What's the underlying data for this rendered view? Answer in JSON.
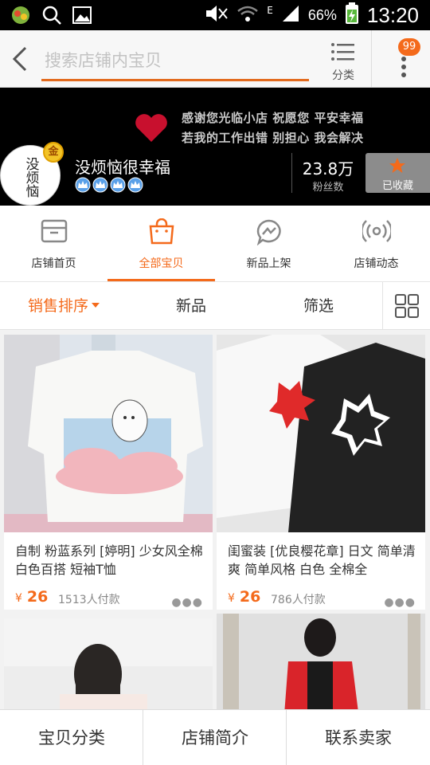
{
  "status_bar": {
    "battery_text": "66%",
    "time": "13:20",
    "network_label": "E"
  },
  "header": {
    "search_placeholder": "搜索店铺内宝贝",
    "category_label": "分类",
    "notification_count": "99"
  },
  "banner": {
    "line1": "感谢您光临小店 祝愿您 平安幸福",
    "line2": "若我的工作出错 别担心 我会解决",
    "avatar_text": "没烦恼",
    "gold_badge": "金",
    "shop_name": "没烦恼很幸福",
    "fans_count": "23.8万",
    "fans_label": "粉丝数",
    "collect_label": "已收藏"
  },
  "tabs": [
    {
      "label": "店铺首页",
      "icon": "store-icon"
    },
    {
      "label": "全部宝贝",
      "icon": "shopping-bag-icon"
    },
    {
      "label": "新品上架",
      "icon": "messenger-icon"
    },
    {
      "label": "店铺动态",
      "icon": "broadcast-icon"
    }
  ],
  "sort": {
    "sales": "销售排序",
    "new": "新品",
    "filter": "筛选"
  },
  "products": [
    {
      "title": "自制 粉蓝系列 [婷明] 少女风全棉 白色百搭 短袖T恤",
      "currency": "¥",
      "price": "26",
      "sales": "1513人付款"
    },
    {
      "title": "闺蜜装 [优良樱花章] 日文 简单清爽 简单风格 白色 全棉全",
      "currency": "¥",
      "price": "26",
      "sales": "786人付款"
    }
  ],
  "bottom_bar": {
    "category": "宝贝分类",
    "intro": "店铺简介",
    "contact": "联系卖家"
  },
  "colors": {
    "accent": "#f46a1b",
    "banner_bg": "#000000"
  }
}
